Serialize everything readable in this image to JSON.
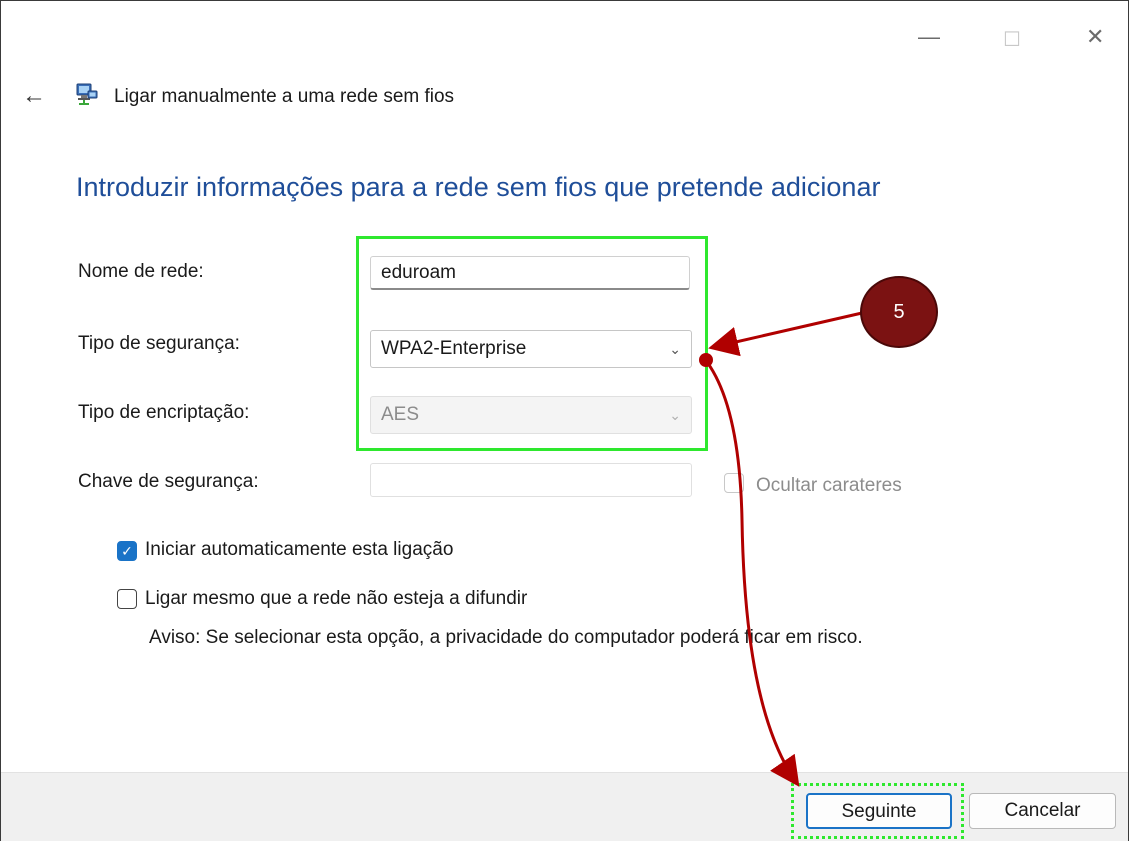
{
  "window": {
    "title": "Ligar manualmente a uma rede sem fios",
    "controls": {
      "minimize": "—",
      "maximize": "☐",
      "close": "✕"
    },
    "back_icon": "←"
  },
  "heading": "Introduzir informações para a rede sem fios que pretende adicionar",
  "form": {
    "network_name_label": "Nome de rede:",
    "network_name_value": "eduroam",
    "security_type_label": "Tipo de segurança:",
    "security_type_value": "WPA2-Enterprise",
    "encryption_type_label": "Tipo de encriptação:",
    "encryption_type_value": "AES",
    "security_key_label": "Chave de segurança:",
    "security_key_value": "",
    "hide_chars_label": "Ocultar carateres"
  },
  "options": {
    "auto_start_label": "Iniciar automaticamente esta ligação",
    "auto_start_checked": true,
    "connect_hidden_label": "Ligar mesmo que a rede não esteja a difundir",
    "connect_hidden_checked": false,
    "warning": "Aviso: Se selecionar esta opção, a privacidade do computador poderá ficar em risco."
  },
  "buttons": {
    "next": "Seguinte",
    "cancel": "Cancelar"
  },
  "annotation": {
    "step_number": "5",
    "highlight_color": "#2ee82e",
    "arrow_color": "#b00000"
  },
  "icons": {
    "back": "back-arrow-icon",
    "app": "network-icon",
    "chevron": "chevron-down-icon",
    "check": "checkmark-icon"
  }
}
